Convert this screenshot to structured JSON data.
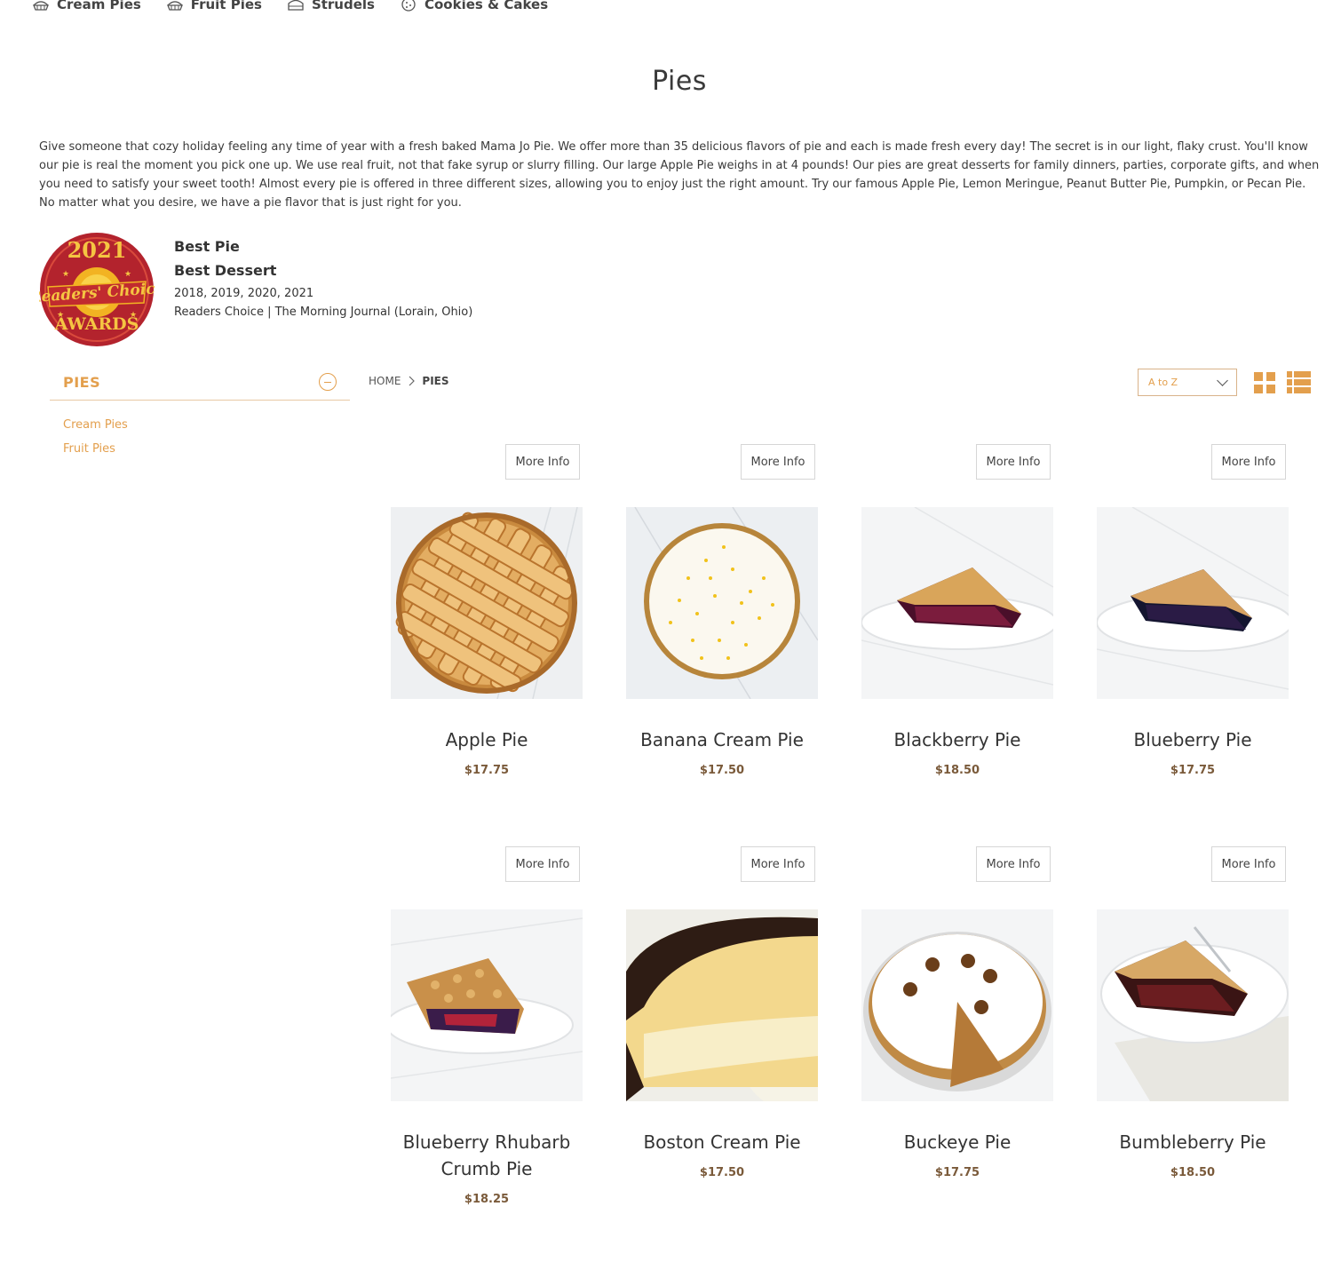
{
  "top_nav": [
    {
      "label": "Cream Pies",
      "icon": "pie-icon"
    },
    {
      "label": "Fruit Pies",
      "icon": "pie-icon"
    },
    {
      "label": "Strudels",
      "icon": "strudel-icon"
    },
    {
      "label": "Cookies & Cakes",
      "icon": "cookie-icon"
    }
  ],
  "page_title": "Pies",
  "intro": "Give someone that cozy holiday feeling any time of year with a fresh baked Mama Jo Pie. We offer more than 35 delicious flavors of pie and each is made fresh every day! The secret is in our light, flaky crust. You'll know our pie is real the moment you pick one up. We use real fruit, not that fake syrup or slurry filling. Our large Apple Pie weighs in at 4 pounds! Our pies are great desserts for family dinners, parties, corporate gifts, and when you need to satisfy your sweet tooth! Almost every pie is offered in three different sizes, allowing you to enjoy just the right amount. Try our famous Apple Pie, Lemon Meringue, Peanut Butter Pie, Pumpkin, or Pecan Pie. No matter what you desire, we have a pie flavor that is just right for you.",
  "award": {
    "badge_year": "2021",
    "badge_script": "Readers' Choice",
    "badge_word": "AWARDS",
    "line1": "Best Pie",
    "line2": "Best Dessert",
    "years": "2018, 2019, 2020, 2021",
    "source": "Readers Choice | The Morning Journal (Lorain, Ohio)"
  },
  "sidebar": {
    "title": "PIES",
    "links": [
      "Cream Pies",
      "Fruit Pies"
    ]
  },
  "breadcrumb": {
    "home": "HOME",
    "current": "PIES"
  },
  "sort": {
    "selected": "A to Z"
  },
  "more_info_label": "More Info",
  "products": [
    {
      "name": "Apple Pie",
      "price": "$17.75"
    },
    {
      "name": "Banana Cream Pie",
      "price": "$17.50"
    },
    {
      "name": "Blackberry Pie",
      "price": "$18.50"
    },
    {
      "name": "Blueberry Pie",
      "price": "$17.75"
    },
    {
      "name": "Blueberry Rhubarb Crumb Pie",
      "price": "$18.25"
    },
    {
      "name": "Boston Cream Pie",
      "price": "$17.50"
    },
    {
      "name": "Buckeye Pie",
      "price": "$17.75"
    },
    {
      "name": "Bumbleberry Pie",
      "price": "$18.50"
    }
  ],
  "colors": {
    "accent": "#e39f4d",
    "price": "#7a5a3a"
  }
}
